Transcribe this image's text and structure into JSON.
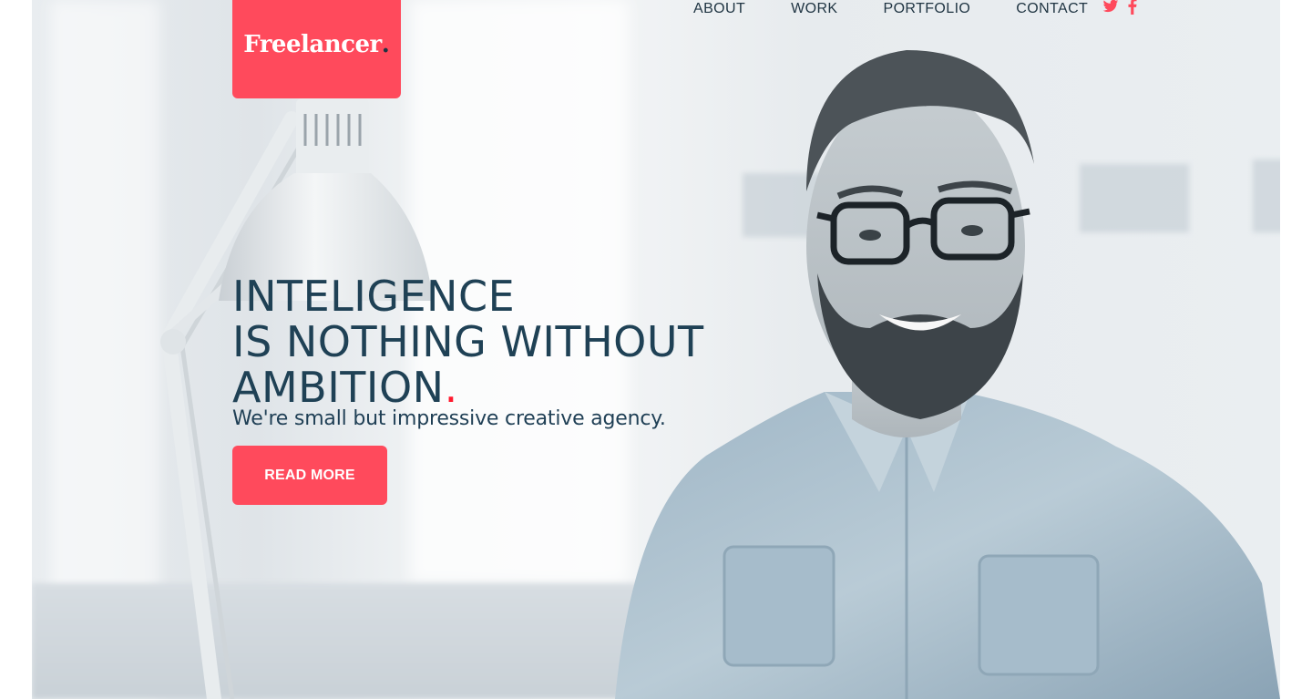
{
  "brand": {
    "logo_text": "Freelancer",
    "logo_dot": ".",
    "accent_color": "#ff4a5c",
    "text_color": "#1f4155"
  },
  "nav": {
    "items": [
      {
        "label": "ABOUT"
      },
      {
        "label": "WORK"
      },
      {
        "label": "PORTFOLIO"
      },
      {
        "label": "CONTACT"
      }
    ],
    "social": [
      {
        "icon": "twitter-icon"
      },
      {
        "icon": "facebook-icon"
      }
    ]
  },
  "hero": {
    "title_lines": [
      "INTELIGENCE",
      "IS NOTHING WITHOUT",
      "AMBITION"
    ],
    "title_dot": ".",
    "subtitle": "We're small but impressive creative agency.",
    "cta_label": "READ MORE"
  }
}
